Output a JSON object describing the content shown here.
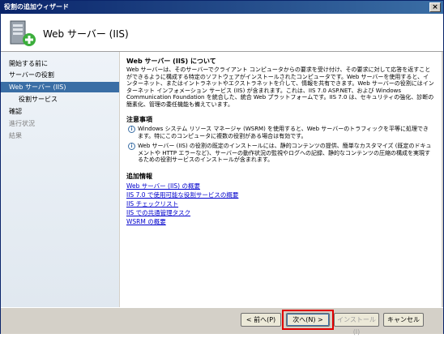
{
  "window": {
    "title": "役割の追加ウィザード",
    "close_label": "×"
  },
  "header": {
    "title": "Web サーバー (IIS)"
  },
  "nav": {
    "items": [
      {
        "label": "開始する前に",
        "state": "normal"
      },
      {
        "label": "サーバーの役割",
        "state": "normal"
      },
      {
        "label": "Web サーバー (IIS)",
        "state": "active"
      },
      {
        "label": "役割サービス",
        "state": "sub"
      },
      {
        "label": "確認",
        "state": "normal"
      },
      {
        "label": "進行状況",
        "state": "disabled"
      },
      {
        "label": "結果",
        "state": "disabled"
      }
    ]
  },
  "content": {
    "intro_heading": "Web サーバー (IIS) について",
    "intro_text": "Web サーバーは、そのサーバーでクライアント コンピュータからの要求を受け付け、その要求に対して応答を返すことができるように構成する特定のソフトウェアがインストールされたコンピュータです。Web サーバーを使用すると、インターネット、またはイントラネットやエクストラネットを介して、情報を共有できます。Web サーバーの役割にはインターネット インフォメーション サービス (IIS) が含まれます。これは、IIS 7.0 ASP.NET、および Windows Communication Foundation を統合した、統合 Web プラットフォームです。IIS 7.0 は、セキュリティの強化、診断の簡素化、管理の委任機能も備えています。",
    "notes_heading": "注意事項",
    "notes": [
      "Windows システム リソース マネージャ (WSRM) を使用すると、Web サーバーのトラフィックを平等に処理できます。特にこのコンピュータに複数の役割がある場合は有効です。",
      "Web サーバー (IIS) の役割の既定のインストールには、静的コンテンツの提供、簡単なカスタマイズ (既定のドキュメントや HTTP エラーなど)、サーバーの動作状況の監視やログへの記録、静的なコンテンツの圧縮の構成を実現するための役割サービスのインストールが含まれます。"
    ],
    "more_heading": "追加情報",
    "links": [
      "Web サーバー (IIS) の概要",
      "IIS 7.0 で使用可能な役割サービスの概要",
      "IIS チェックリスト",
      "IIS での共通管理タスク",
      "WSRM の概要"
    ]
  },
  "buttons": {
    "back": "< 前へ(P)",
    "next": "次へ(N) >",
    "install": "インストール(I)",
    "cancel": "キャンセル"
  },
  "colors": {
    "highlight": "#e00000",
    "active_nav": "#3a6ea5",
    "link": "#0000cc"
  }
}
